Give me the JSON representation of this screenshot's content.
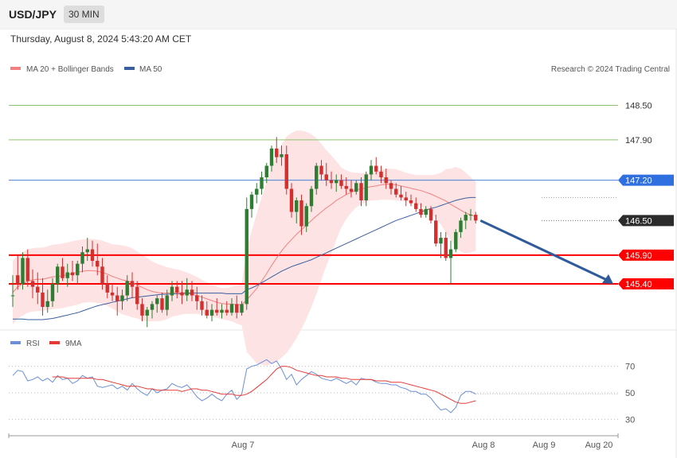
{
  "header": {
    "symbol": "USD/JPY",
    "timeframe": "30 MIN",
    "datetime": "Thursday, August 8, 2024 5:43:20 AM CET"
  },
  "legend": {
    "ma20_bb": "MA 20 + Bollinger Bands",
    "ma50": "MA 50",
    "rsi": "RSI",
    "ma9": "9MA"
  },
  "credit": "Research © 2024 Trading Central",
  "colors": {
    "up": "#2e7d32",
    "down": "#d32f2f",
    "bb_fill": "#fde3e3",
    "ma20": "#f28080",
    "ma50": "#3b5f9e",
    "green_level": "#8cc56a",
    "blue_level": "#4d80d8",
    "red_level": "#ff0000",
    "rsi": "#6b8fd8",
    "rsi_ma": "#e53935",
    "arrow": "#2f5b9a"
  },
  "chart_data": [
    {
      "type": "candlestick",
      "title": "USD/JPY",
      "ylim": [
        144.6,
        149.5
      ],
      "x_tick_labels": [
        "Aug 7",
        "Aug 8",
        "Aug 9",
        "Aug 20"
      ],
      "levels": [
        {
          "value": 148.5,
          "label": "148.50",
          "kind": "resistance-green"
        },
        {
          "value": 147.9,
          "label": "147.90",
          "kind": "resistance-green"
        },
        {
          "value": 147.2,
          "label": "147.20",
          "kind": "blue"
        },
        {
          "value": 146.5,
          "label": "146.50",
          "kind": "last-price"
        },
        {
          "value": 145.9,
          "label": "145.90",
          "kind": "support-red"
        },
        {
          "value": 145.4,
          "label": "145.40",
          "kind": "support-red"
        }
      ],
      "candles": [
        [
          145.2,
          145.55,
          145.0,
          145.2
        ],
        [
          145.55,
          145.9,
          145.3,
          145.4
        ],
        [
          145.4,
          145.95,
          145.3,
          145.85
        ],
        [
          145.85,
          146.0,
          145.35,
          145.45
        ],
        [
          145.45,
          145.65,
          145.15,
          145.35
        ],
        [
          145.35,
          145.6,
          145.05,
          145.25
        ],
        [
          145.25,
          145.5,
          144.85,
          145.0
        ],
        [
          145.0,
          145.3,
          144.9,
          145.1
        ],
        [
          145.1,
          145.5,
          145.0,
          145.4
        ],
        [
          145.4,
          145.75,
          145.25,
          145.7
        ],
        [
          145.7,
          145.85,
          145.45,
          145.5
        ],
        [
          145.5,
          145.75,
          145.35,
          145.6
        ],
        [
          145.6,
          145.8,
          145.45,
          145.55
        ],
        [
          145.55,
          145.8,
          145.4,
          145.75
        ],
        [
          145.75,
          146.05,
          145.6,
          145.95
        ],
        [
          145.95,
          146.2,
          145.8,
          146.0
        ],
        [
          146.0,
          146.15,
          145.7,
          145.8
        ],
        [
          145.8,
          146.1,
          145.55,
          145.7
        ],
        [
          145.7,
          145.85,
          145.3,
          145.4
        ],
        [
          145.4,
          145.55,
          145.15,
          145.25
        ],
        [
          145.25,
          145.4,
          145.1,
          145.2
        ],
        [
          145.2,
          145.35,
          144.85,
          145.1
        ],
        [
          145.1,
          145.3,
          144.95,
          145.2
        ],
        [
          145.2,
          145.55,
          145.1,
          145.45
        ],
        [
          145.45,
          145.6,
          145.15,
          145.35
        ],
        [
          145.35,
          145.45,
          144.95,
          145.05
        ],
        [
          145.05,
          145.15,
          144.75,
          144.85
        ],
        [
          144.85,
          145.0,
          144.65,
          144.95
        ],
        [
          144.95,
          145.1,
          144.8,
          145.05
        ],
        [
          145.05,
          145.2,
          144.9,
          145.15
        ],
        [
          145.15,
          145.25,
          144.9,
          144.95
        ],
        [
          144.95,
          145.3,
          144.85,
          145.2
        ],
        [
          145.2,
          145.45,
          145.1,
          145.35
        ],
        [
          145.35,
          145.45,
          145.15,
          145.25
        ],
        [
          145.25,
          145.45,
          145.05,
          145.2
        ],
        [
          145.2,
          145.5,
          145.1,
          145.3
        ],
        [
          145.3,
          145.45,
          145.1,
          145.2
        ],
        [
          145.2,
          145.35,
          144.95,
          145.1
        ],
        [
          145.1,
          145.2,
          144.85,
          144.95
        ],
        [
          144.95,
          145.1,
          144.8,
          144.85
        ],
        [
          144.85,
          145.05,
          144.75,
          144.95
        ],
        [
          144.95,
          145.15,
          144.85,
          144.9
        ],
        [
          144.9,
          145.05,
          144.8,
          144.95
        ],
        [
          144.95,
          145.1,
          144.85,
          144.9
        ],
        [
          144.9,
          145.15,
          144.85,
          145.05
        ],
        [
          145.05,
          145.2,
          144.8,
          144.9
        ],
        [
          144.9,
          145.1,
          144.85,
          145.05
        ],
        [
          145.05,
          146.9,
          144.95,
          146.7
        ],
        [
          146.7,
          147.0,
          146.55,
          146.95
        ],
        [
          146.95,
          147.15,
          146.8,
          147.05
        ],
        [
          147.05,
          147.35,
          146.95,
          147.25
        ],
        [
          147.25,
          147.5,
          147.15,
          147.45
        ],
        [
          147.45,
          147.8,
          147.35,
          147.75
        ],
        [
          147.75,
          147.95,
          147.5,
          147.6
        ],
        [
          147.6,
          147.8,
          147.45,
          147.65
        ],
        [
          147.65,
          147.8,
          146.95,
          147.05
        ],
        [
          147.05,
          147.15,
          146.55,
          146.65
        ],
        [
          146.65,
          146.9,
          146.45,
          146.85
        ],
        [
          146.85,
          146.95,
          146.25,
          146.4
        ],
        [
          146.4,
          146.8,
          146.3,
          146.75
        ],
        [
          146.75,
          147.1,
          146.65,
          147.05
        ],
        [
          147.05,
          147.5,
          146.95,
          147.45
        ],
        [
          147.45,
          147.55,
          147.2,
          147.3
        ],
        [
          147.3,
          147.5,
          147.1,
          147.2
        ],
        [
          147.2,
          147.35,
          147.05,
          147.15
        ],
        [
          147.15,
          147.3,
          147.0,
          147.2
        ],
        [
          147.2,
          147.3,
          147.05,
          147.1
        ],
        [
          147.1,
          147.25,
          146.95,
          147.05
        ],
        [
          147.05,
          147.2,
          146.9,
          147.0
        ],
        [
          147.0,
          147.2,
          146.95,
          147.15
        ],
        [
          147.15,
          147.25,
          146.75,
          146.85
        ],
        [
          146.85,
          147.35,
          146.75,
          147.3
        ],
        [
          147.3,
          147.55,
          147.2,
          147.45
        ],
        [
          147.45,
          147.6,
          147.3,
          147.35
        ],
        [
          147.35,
          147.45,
          147.15,
          147.25
        ],
        [
          147.25,
          147.4,
          147.05,
          147.15
        ],
        [
          147.15,
          147.2,
          146.95,
          147.05
        ],
        [
          147.05,
          147.15,
          146.9,
          146.95
        ],
        [
          146.95,
          147.1,
          146.85,
          146.9
        ],
        [
          146.9,
          147.0,
          146.75,
          146.85
        ],
        [
          146.85,
          146.95,
          146.75,
          146.8
        ],
        [
          146.8,
          146.9,
          146.65,
          146.7
        ],
        [
          146.7,
          146.8,
          146.55,
          146.6
        ],
        [
          146.6,
          146.75,
          146.55,
          146.7
        ],
        [
          146.7,
          146.75,
          146.45,
          146.5
        ],
        [
          146.5,
          146.6,
          146.05,
          146.1
        ],
        [
          146.1,
          146.3,
          145.85,
          146.2
        ],
        [
          146.2,
          146.3,
          145.8,
          145.85
        ],
        [
          145.85,
          146.15,
          145.4,
          146.0
        ],
        [
          146.0,
          146.35,
          145.95,
          146.3
        ],
        [
          146.3,
          146.55,
          146.2,
          146.5
        ],
        [
          146.5,
          146.65,
          146.35,
          146.6
        ],
        [
          146.6,
          146.7,
          146.5,
          146.6
        ],
        [
          146.6,
          146.65,
          146.45,
          146.5
        ]
      ],
      "ma20": [
        145.25,
        145.35,
        145.4,
        145.45,
        145.47,
        145.48,
        145.48,
        145.5,
        145.52,
        145.53,
        145.54,
        145.56,
        145.58,
        145.6,
        145.62,
        145.63,
        145.63,
        145.62,
        145.6,
        145.57,
        145.53,
        145.5,
        145.47,
        145.45,
        145.42,
        145.38,
        145.34,
        145.3,
        145.27,
        145.25,
        145.24,
        145.24,
        145.25,
        145.25,
        145.25,
        145.24,
        145.22,
        145.2,
        145.17,
        145.14,
        145.11,
        145.08,
        145.06,
        145.05,
        145.05,
        145.04,
        145.04,
        145.12,
        145.22,
        145.32,
        145.45,
        145.58,
        145.72,
        145.85,
        145.97,
        146.08,
        146.17,
        146.26,
        146.34,
        146.42,
        146.5,
        146.58,
        146.65,
        146.72,
        146.78,
        146.85,
        146.9,
        146.95,
        146.99,
        147.03,
        147.05,
        147.07,
        147.09,
        147.1,
        147.12,
        147.13,
        147.13,
        147.12,
        147.1,
        147.08,
        147.06,
        147.04,
        147.02,
        146.99,
        146.96,
        146.92,
        146.88,
        146.84,
        146.78,
        146.73,
        146.68,
        146.63,
        146.6,
        146.57
      ],
      "bb_width": [
        0.55,
        0.55,
        0.55,
        0.55,
        0.55,
        0.55,
        0.55,
        0.55,
        0.56,
        0.56,
        0.56,
        0.56,
        0.56,
        0.56,
        0.55,
        0.55,
        0.55,
        0.55,
        0.55,
        0.55,
        0.56,
        0.58,
        0.6,
        0.6,
        0.6,
        0.58,
        0.57,
        0.55,
        0.52,
        0.5,
        0.48,
        0.45,
        0.42,
        0.4,
        0.38,
        0.36,
        0.34,
        0.32,
        0.3,
        0.29,
        0.28,
        0.27,
        0.27,
        0.28,
        0.3,
        0.33,
        0.36,
        0.9,
        1.1,
        1.3,
        1.45,
        1.6,
        1.7,
        1.8,
        1.85,
        1.88,
        1.85,
        1.8,
        1.72,
        1.62,
        1.5,
        1.35,
        1.18,
        1.0,
        0.85,
        0.68,
        0.52,
        0.42,
        0.35,
        0.3,
        0.27,
        0.25,
        0.24,
        0.25,
        0.26,
        0.27,
        0.27,
        0.27,
        0.26,
        0.25,
        0.25,
        0.25,
        0.27,
        0.3,
        0.33,
        0.38,
        0.45,
        0.55,
        0.62,
        0.7,
        0.72,
        0.7,
        0.65,
        0.6
      ],
      "ma50": [
        144.79,
        144.79,
        144.79,
        144.78,
        144.78,
        144.78,
        144.78,
        144.79,
        144.8,
        144.82,
        144.84,
        144.86,
        144.88,
        144.9,
        144.93,
        144.96,
        144.99,
        145.02,
        145.04,
        145.06,
        145.08,
        145.1,
        145.12,
        145.14,
        145.16,
        145.17,
        145.18,
        145.19,
        145.2,
        145.21,
        145.22,
        145.22,
        145.23,
        145.23,
        145.23,
        145.24,
        145.24,
        145.24,
        145.24,
        145.24,
        145.24,
        145.24,
        145.24,
        145.23,
        145.23,
        145.23,
        145.23,
        145.3,
        145.33,
        145.37,
        145.42,
        145.47,
        145.52,
        145.57,
        145.62,
        145.66,
        145.7,
        145.73,
        145.76,
        145.79,
        145.82,
        145.86,
        145.9,
        145.94,
        145.98,
        146.02,
        146.06,
        146.1,
        146.14,
        146.18,
        146.22,
        146.26,
        146.3,
        146.34,
        146.38,
        146.42,
        146.46,
        146.5,
        146.53,
        146.56,
        146.59,
        146.62,
        146.65,
        146.68,
        146.71,
        146.73,
        146.76,
        146.79,
        146.82,
        146.85,
        146.87,
        146.89,
        146.9,
        146.9
      ],
      "forecast_arrow": {
        "from": 146.5,
        "to": 145.4
      }
    },
    {
      "type": "line",
      "title": "RSI",
      "ylim": [
        20,
        80
      ],
      "y_ticks": [
        30,
        50,
        70
      ],
      "series": [
        {
          "name": "RSI",
          "values": [
            63,
            67,
            66,
            59,
            60,
            62,
            59,
            61,
            58,
            63,
            60,
            61,
            57,
            59,
            63,
            61,
            62,
            55,
            54,
            55,
            56,
            53,
            55,
            52,
            57,
            53,
            50,
            48,
            53,
            50,
            52,
            53,
            57,
            55,
            54,
            56,
            52,
            47,
            44,
            46,
            49,
            46,
            44,
            49,
            52,
            45,
            49,
            68,
            70,
            71,
            73,
            75,
            72,
            74,
            68,
            60,
            64,
            56,
            60,
            63,
            66,
            64,
            61,
            60,
            59,
            61,
            59,
            57,
            59,
            56,
            61,
            60,
            60,
            58,
            57,
            57,
            56,
            56,
            54,
            53,
            51,
            51,
            49,
            49,
            46,
            41,
            37,
            38,
            35,
            39,
            48,
            51,
            51,
            49
          ]
        },
        {
          "name": "9MA",
          "values": [
            null,
            null,
            null,
            null,
            null,
            null,
            null,
            null,
            62,
            62,
            62,
            61,
            61,
            61,
            61,
            61,
            61,
            60,
            60,
            59,
            58,
            57,
            56,
            55,
            55,
            55,
            54,
            53,
            53,
            52,
            52,
            52,
            52,
            52,
            51,
            52,
            53,
            53,
            52,
            52,
            51,
            50,
            49,
            49,
            49,
            48,
            48,
            49,
            51,
            54,
            57,
            60,
            64,
            68,
            70,
            70,
            69,
            67,
            66,
            65,
            64,
            63,
            63,
            62,
            62,
            62,
            61,
            61,
            60,
            60,
            60,
            60,
            60,
            59,
            59,
            59,
            58,
            58,
            58,
            57,
            56,
            55,
            54,
            53,
            52,
            51,
            49,
            47,
            45,
            43,
            42,
            42,
            43,
            44
          ]
        }
      ]
    }
  ]
}
